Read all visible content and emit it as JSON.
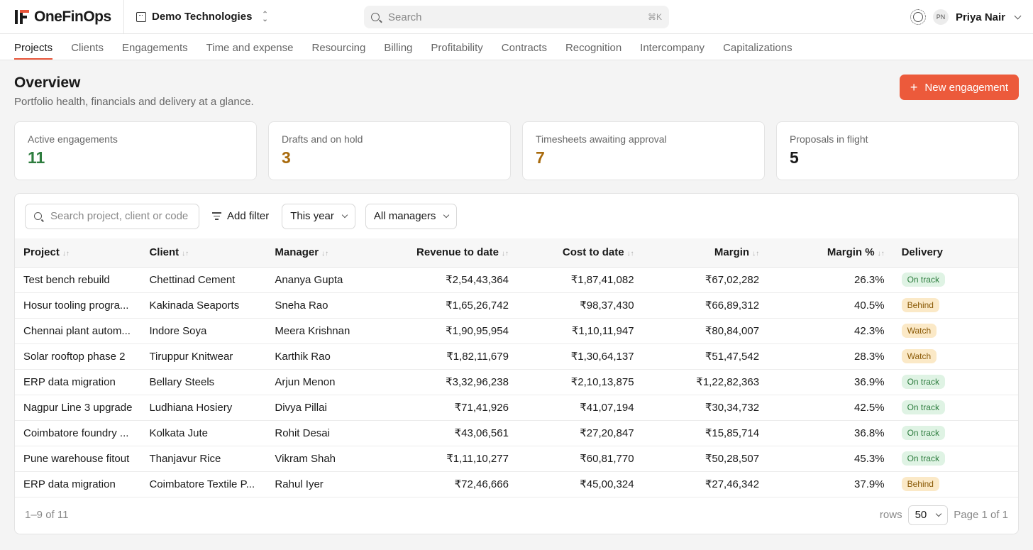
{
  "brand": {
    "name": "OneFinOps"
  },
  "org": {
    "name": "Demo Technologies"
  },
  "search": {
    "placeholder": "Search",
    "shortcut": "⌘K"
  },
  "user": {
    "initials": "PN",
    "name": "Priya Nair"
  },
  "tabs": [
    {
      "label": "Projects",
      "active": true
    },
    {
      "label": "Clients"
    },
    {
      "label": "Engagements"
    },
    {
      "label": "Time and expense"
    },
    {
      "label": "Resourcing"
    },
    {
      "label": "Billing"
    },
    {
      "label": "Profitability"
    },
    {
      "label": "Contracts"
    },
    {
      "label": "Recognition"
    },
    {
      "label": "Intercompany"
    },
    {
      "label": "Capitalizations"
    }
  ],
  "page": {
    "title": "Overview",
    "subtitle": "Portfolio health, financials and delivery at a glance.",
    "new_button": "New engagement"
  },
  "stats": [
    {
      "label": "Active engagements",
      "value": "11",
      "color": "#2e7d3f"
    },
    {
      "label": "Drafts and on hold",
      "value": "3",
      "color": "#a86a0c"
    },
    {
      "label": "Timesheets awaiting approval",
      "value": "7",
      "color": "#a86a0c"
    },
    {
      "label": "Proposals in flight",
      "value": "5",
      "color": "#1a1a1a"
    }
  ],
  "filters": {
    "search_placeholder": "Search project, client or code",
    "add_filter": "Add filter",
    "period": "This year",
    "manager": "All managers"
  },
  "table": {
    "columns": [
      "Project",
      "Client",
      "Manager",
      "Revenue to date",
      "Cost to date",
      "Margin",
      "Margin %",
      "Delivery"
    ],
    "rows": [
      [
        "Test bench rebuild",
        "Chettinad Cement",
        "Ananya Gupta",
        "₹2,54,43,364",
        "₹1,87,41,082",
        "₹67,02,282",
        "26.3%",
        "On track"
      ],
      [
        "Hosur tooling progra...",
        "Kakinada Seaports",
        "Sneha Rao",
        "₹1,65,26,742",
        "₹98,37,430",
        "₹66,89,312",
        "40.5%",
        "Behind"
      ],
      [
        "Chennai plant autom...",
        "Indore Soya",
        "Meera Krishnan",
        "₹1,90,95,954",
        "₹1,10,11,947",
        "₹80,84,007",
        "42.3%",
        "Watch"
      ],
      [
        "Solar rooftop phase 2",
        "Tiruppur Knitwear",
        "Karthik Rao",
        "₹1,82,11,679",
        "₹1,30,64,137",
        "₹51,47,542",
        "28.3%",
        "Watch"
      ],
      [
        "ERP data migration",
        "Bellary Steels",
        "Arjun Menon",
        "₹3,32,96,238",
        "₹2,10,13,875",
        "₹1,22,82,363",
        "36.9%",
        "On track"
      ],
      [
        "Nagpur Line 3 upgrade",
        "Ludhiana Hosiery",
        "Divya Pillai",
        "₹71,41,926",
        "₹41,07,194",
        "₹30,34,732",
        "42.5%",
        "On track"
      ],
      [
        "Coimbatore foundry ...",
        "Kolkata Jute",
        "Rohit Desai",
        "₹43,06,561",
        "₹27,20,847",
        "₹15,85,714",
        "36.8%",
        "On track"
      ],
      [
        "Pune warehouse fitout",
        "Thanjavur Rice",
        "Vikram Shah",
        "₹1,11,10,277",
        "₹60,81,770",
        "₹50,28,507",
        "45.3%",
        "On track"
      ],
      [
        "ERP data migration",
        "Coimbatore Textile P...",
        "Rahul Iyer",
        "₹72,46,666",
        "₹45,00,324",
        "₹27,46,342",
        "37.9%",
        "Behind"
      ]
    ]
  },
  "status_colors": {
    "On track": {
      "bg": "#dff3e4",
      "fg": "#2e7d3f"
    },
    "Behind": {
      "bg": "#fbe9c7",
      "fg": "#8a5a07"
    },
    "Watch": {
      "bg": "#fbe9c7",
      "fg": "#8a5a07"
    }
  },
  "footer": {
    "range": "1–9 of 11",
    "rows_label": "rows",
    "rows_value": "50",
    "page": "Page 1 of 1"
  }
}
